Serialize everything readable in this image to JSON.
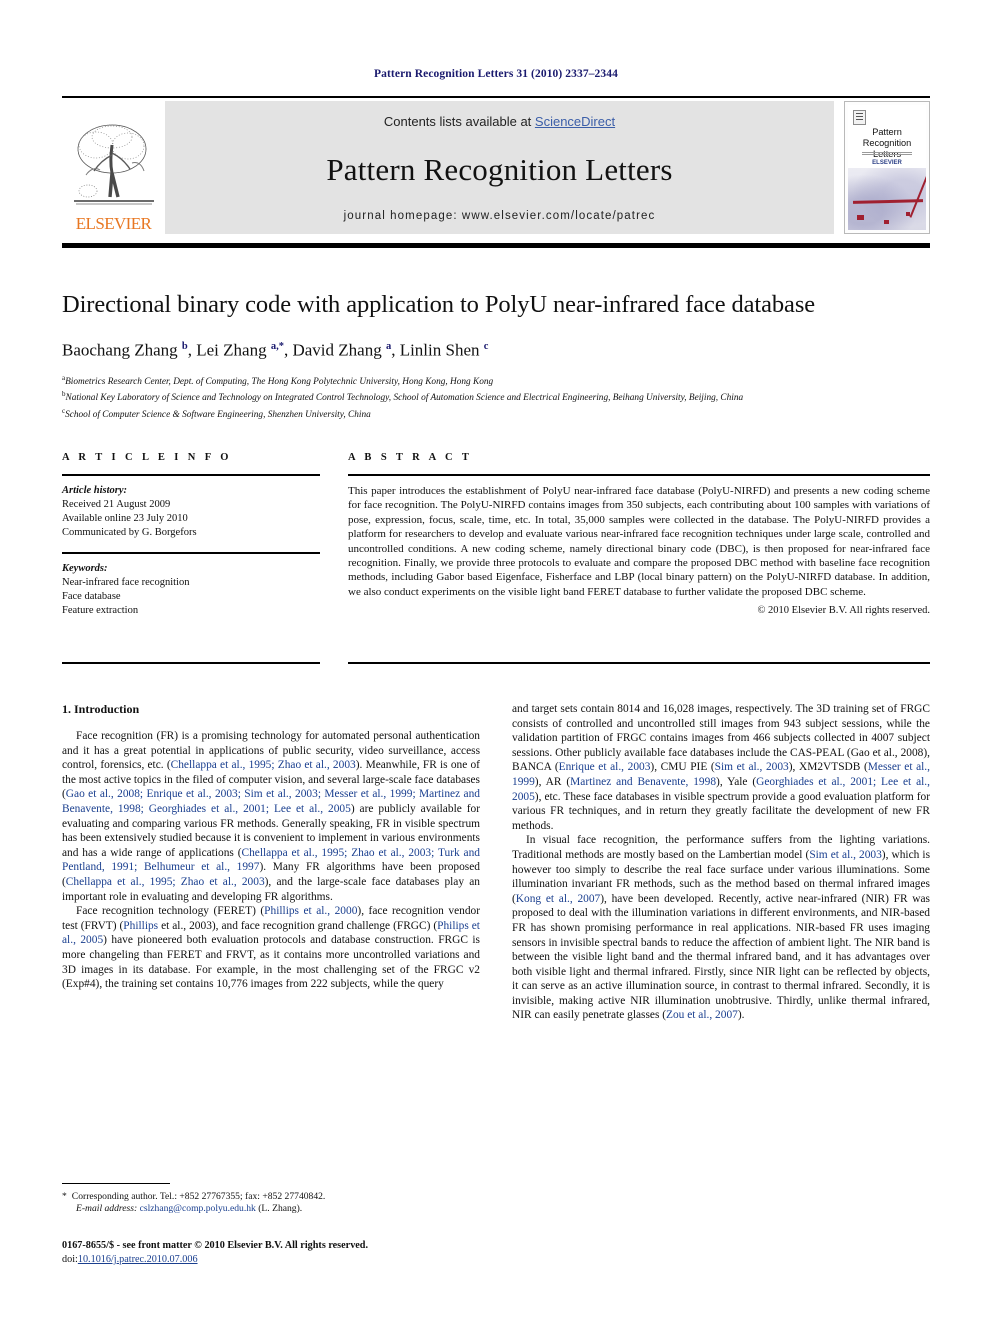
{
  "running_head": "Pattern Recognition Letters 31 (2010) 2337–2344",
  "masthead": {
    "publisher_name": "ELSEVIER",
    "contents_prefix": "Contents lists available at ",
    "contents_link": "ScienceDirect",
    "journal_title": "Pattern Recognition Letters",
    "homepage_line": "journal homepage: www.elsevier.com/locate/patrec",
    "cover_title_line1": "Pattern Recognition",
    "cover_title_line2": "Letters",
    "cover_publisher": "ELSEVIER"
  },
  "article": {
    "title": "Directional binary code with application to PolyU near-infrared face database",
    "authors_html": "Baochang Zhang <sup>b</sup>, Lei Zhang <sup>a,*</sup>, David Zhang <sup>a</sup>, Linlin Shen <sup>c</sup>",
    "affiliations": [
      {
        "marker": "a",
        "text": "Biometrics Research Center, Dept. of Computing, The Hong Kong Polytechnic University, Hong Kong, Hong Kong"
      },
      {
        "marker": "b",
        "text": "National Key Laboratory of Science and Technology on Integrated Control Technology, School of Automation Science and Electrical Engineering, Beihang University, Beijing, China"
      },
      {
        "marker": "c",
        "text": "School of Computer Science & Software Engineering, Shenzhen University, China"
      }
    ]
  },
  "article_info": {
    "heading": "A R T I C L E   I N F O",
    "history_label": "Article history:",
    "history": [
      "Received 21 August 2009",
      "Available online 23 July 2010",
      "Communicated by G. Borgefors"
    ],
    "keywords_label": "Keywords:",
    "keywords": [
      "Near-infrared face recognition",
      "Face database",
      "Feature extraction"
    ]
  },
  "abstract": {
    "heading": "A B S T R A C T",
    "text": "This paper introduces the establishment of PolyU near-infrared face database (PolyU-NIRFD) and presents a new coding scheme for face recognition. The PolyU-NIRFD contains images from 350 subjects, each contributing about 100 samples with variations of pose, expression, focus, scale, time, etc. In total, 35,000 samples were collected in the database. The PolyU-NIRFD provides a platform for researchers to develop and evaluate various near-infrared face recognition techniques under large scale, controlled and uncontrolled conditions. A new coding scheme, namely directional binary code (DBC), is then proposed for near-infrared face recognition. Finally, we provide three protocols to evaluate and compare the proposed DBC method with baseline face recognition methods, including Gabor based Eigenface, Fisherface and LBP (local binary pattern) on the PolyU-NIRFD database. In addition, we also conduct experiments on the visible light band FERET database to further validate the proposed DBC scheme.",
    "copyright": "© 2010 Elsevier B.V. All rights reserved."
  },
  "body": {
    "section_heading": "1. Introduction",
    "left_paragraphs_html": [
      "Face recognition (FR) is a promising technology for automated personal authentication and it has a great potential in applications of public security, video surveillance, access control, forensics, etc. (<span class=\"ref\">Chellappa et al., 1995; Zhao et al., 2003</span>). Meanwhile, FR is one of the most active topics in the filed of computer vision, and several large-scale face databases (<span class=\"ref\">Gao et al., 2008; Enrique et al., 2003; Sim et al., 2003; Messer et al., 1999; Martinez and Benavente, 1998; Georghiades et al., 2001; Lee et al., 2005</span>) are publicly available for evaluating and comparing various FR methods. Generally speaking, FR in visible spectrum has been extensively studied because it is convenient to implement in various environments and has a wide range of applications (<span class=\"ref\">Chellappa et al., 1995; Zhao et al., 2003; Turk and Pentland, 1991; Belhumeur et al., 1997</span>). Many FR algorithms have been proposed (<span class=\"ref\">Chellappa et al., 1995; Zhao et al., 2003</span>), and the large-scale face databases play an important role in evaluating and developing FR algorithms.",
      "Face recognition technology (FERET) (<span class=\"ref\">Phillips et al., 2000</span>), face recognition vendor test (FRVT) (<span class=\"ref\">Phillips</span> et al., 2003), and face recognition grand challenge (FRGC) (<span class=\"ref\">Philips et al., 2005</span>) have pioneered both evaluation protocols and database construction. FRGC is more changeling than FERET and FRVT, as it contains more uncontrolled variations and 3D images in its database. For example, in the most challenging set of the FRGC v2 (Exp#4), the training set contains 10,776 images from 222 subjects, while the query"
    ],
    "right_paragraphs_html": [
      "and target sets contain 8014 and 16,028 images, respectively. The 3D training set of FRGC consists of controlled and uncontrolled still images from 943 subject sessions, while the validation partition of FRGC contains images from 466 subjects collected in 4007 subject sessions. Other publicly available face databases include the CAS-PEAL (Gao et al., 2008), BANCA (<span class=\"ref\">Enrique et al., 2003</span>), CMU PIE (<span class=\"ref\">Sim et al., 2003</span>), XM2VTSDB (<span class=\"ref\">Messer et al., 1999</span>), AR (<span class=\"ref\">Martinez and Benavente, 1998</span>), Yale (<span class=\"ref\">Georghiades et al., 2001; Lee et al., 2005</span>), etc. These face databases in visible spectrum provide a good evaluation platform for various FR techniques, and in return they greatly facilitate the development of new FR methods.",
      "In visual face recognition, the performance suffers from the lighting variations. Traditional methods are mostly based on the Lambertian model (<span class=\"ref\">Sim et al., 2003</span>), which is however too simply to describe the real face surface under various illuminations. Some illumination invariant FR methods, such as the method based on thermal infrared images (<span class=\"ref\">Kong et al., 2007</span>), have been developed. Recently, active near-infrared (NIR) FR was proposed to deal with the illumination variations in different environments, and NIR-based FR has shown promising performance in real applications. NIR-based FR uses imaging sensors in invisible spectral bands to reduce the affection of ambient light. The NIR band is between the visible light band and the thermal infrared band, and it has advantages over both visible light and thermal infrared. Firstly, since NIR light can be reflected by objects, it can serve as an active illumination source, in contrast to thermal infrared. Secondly, it is invisible, making active NIR illumination unobtrusive. Thirdly, unlike thermal infrared, NIR can easily penetrate glasses (<span class=\"ref\">Zou et al., 2007</span>)."
    ]
  },
  "footnote": {
    "star": "*",
    "corresponding": "Corresponding author. Tel.: +852 27767355; fax: +852 27740842.",
    "email_label": "E-mail address:",
    "email": "cslzhang@comp.polyu.edu.hk",
    "email_suffix": "(L. Zhang)."
  },
  "page_footer": {
    "issn_line": "0167-8655/$ - see front matter © 2010 Elsevier B.V. All rights reserved.",
    "doi_label": "doi:",
    "doi": "10.1016/j.patrec.2010.07.006"
  },
  "colors": {
    "link_blue": "#1a3f8f",
    "running_head_blue": "#1a1a6e",
    "elsevier_orange": "#E87722",
    "masthead_gray": "#e3e3e3"
  }
}
